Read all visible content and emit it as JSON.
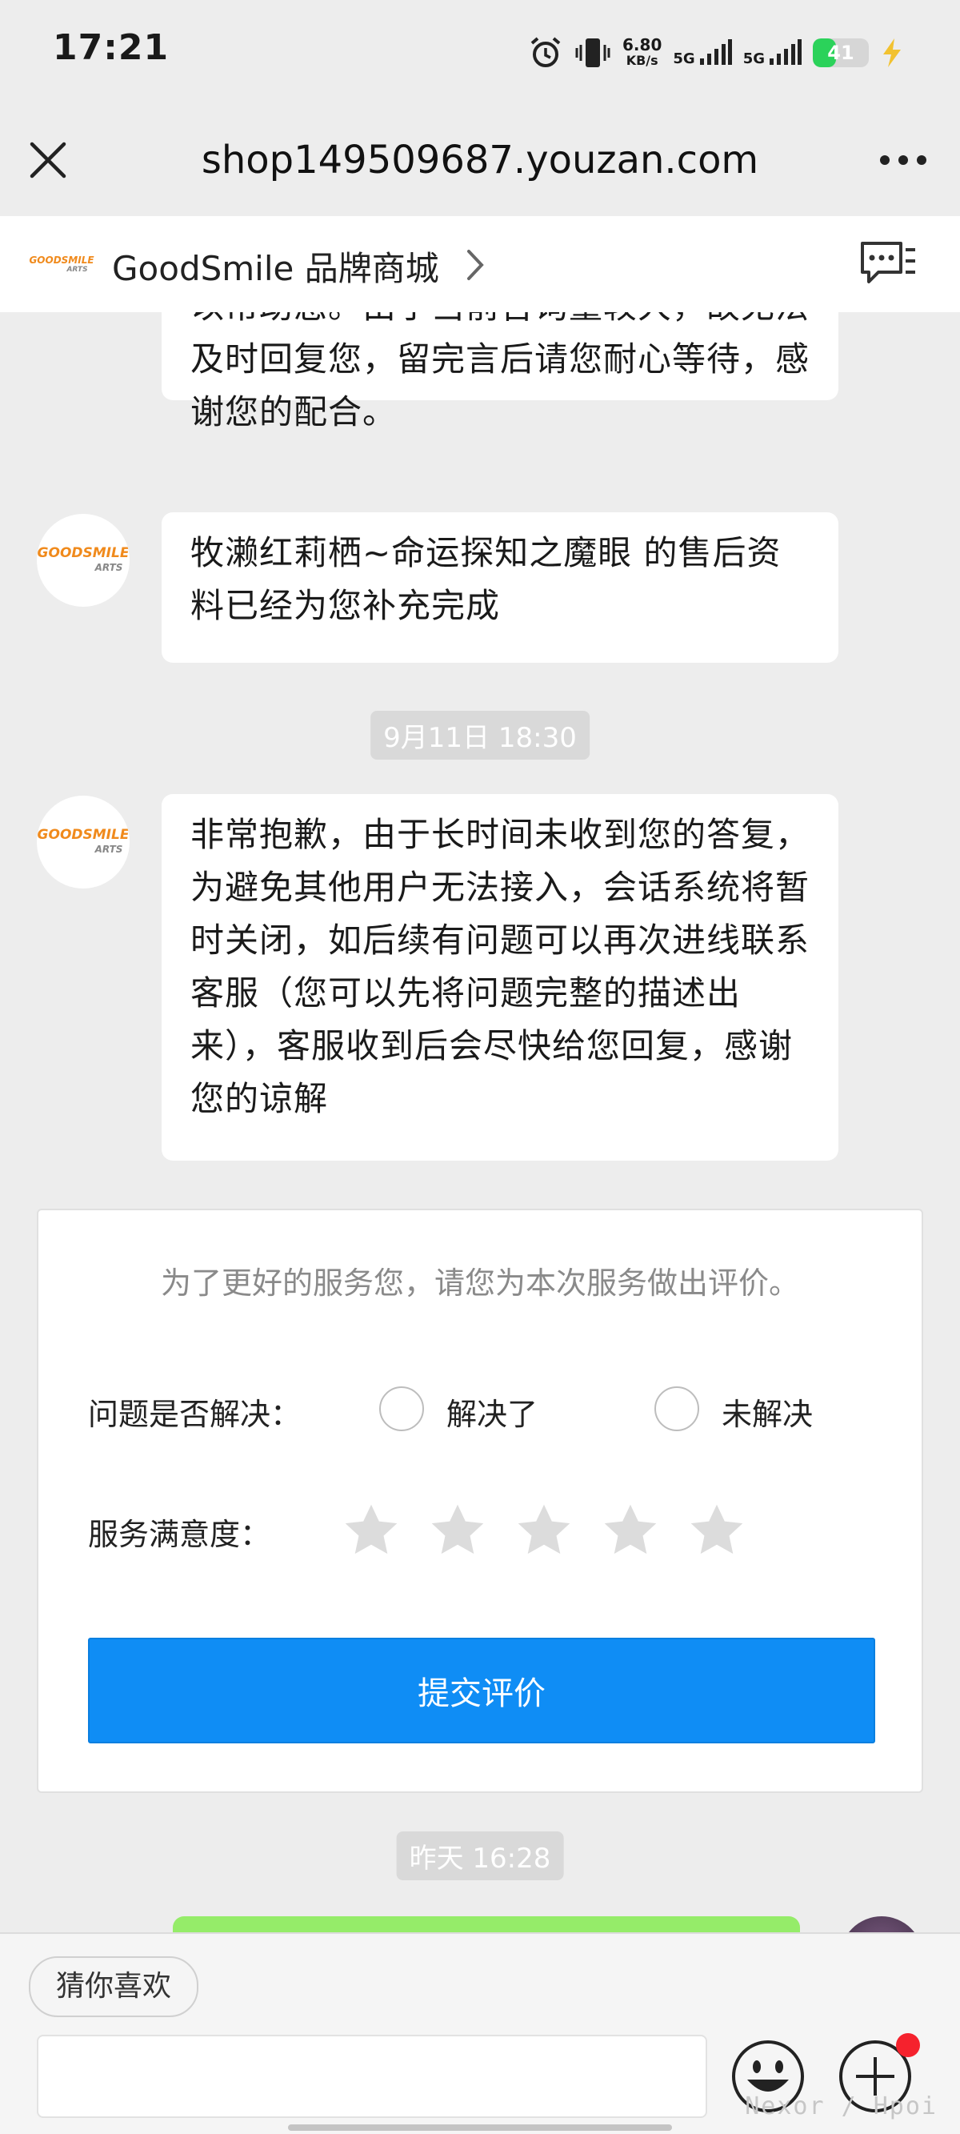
{
  "status_bar": {
    "time": "17:21",
    "speed_value": "6.80",
    "speed_unit": "KB/s",
    "network_1": "5G",
    "network_2": "5G",
    "battery": "41",
    "battery_level": 0.41,
    "battery_color": "#2bd25a"
  },
  "browser": {
    "url": "shop149509687.youzan.com",
    "close_icon": "close-icon",
    "more_icon": "more-icon"
  },
  "shop_header": {
    "name": "GoodSmile 品牌商城",
    "logo_text": "GOODSMILE",
    "logo_subtext": "ARTS"
  },
  "messages": [
    {
      "text": "以帮助您。由于当前咨询量较大，故无法及时回复您，留完言后请您耐心等待，感谢您的配合。"
    },
    {
      "text": "牧濑红莉栖~命运探知之魔眼 的售后资料已经为您补充完成"
    },
    {
      "timestamp": "9月11日 18:30"
    },
    {
      "text": "非常抱歉，由于长时间未收到您的答复，为避免其他用户无法接入，会话系统将暂时关闭，如后续有问题可以再次进线联系客服（您可以先将问题完整的描述出来），客服收到后会尽快给您回复，感谢您的谅解"
    }
  ],
  "rating": {
    "prompt": "为了更好的服务您，请您为本次服务做出评价。",
    "resolved_label": "问题是否解决：",
    "option_resolved": "解决了",
    "option_unresolved": "未解决",
    "satisfaction_label": "服务满意度：",
    "stars_total": 5,
    "stars_selected": 0,
    "submit_label": "提交评价",
    "accent_color": "#0f8df5"
  },
  "later_timestamp": "昨天 16:28",
  "bottom_bar": {
    "chip_label": "猜你喜欢",
    "input_value": "",
    "emoji_icon": "emoji-icon",
    "plus_icon": "plus-icon",
    "watermark": "Nexor / Hpoi"
  }
}
